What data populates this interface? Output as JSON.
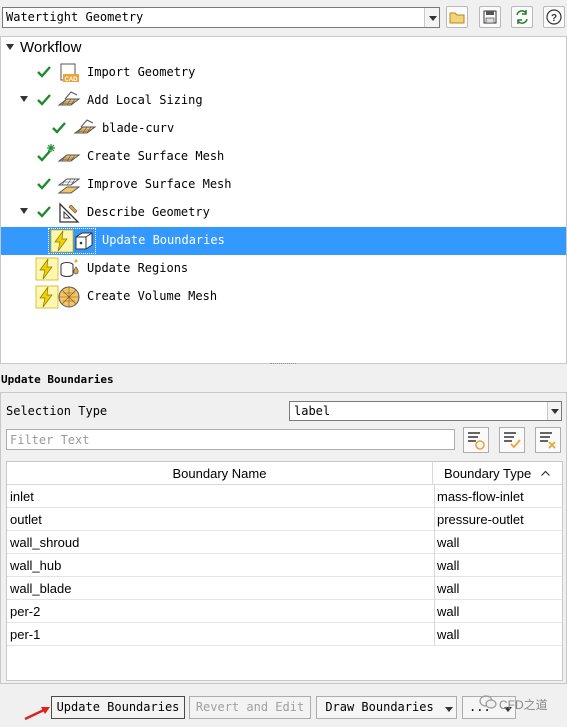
{
  "header": {
    "workflow_select": "Watertight Geometry"
  },
  "tree": {
    "root": "Workflow",
    "items": [
      {
        "label": "Import Geometry"
      },
      {
        "label": "Add Local Sizing"
      },
      {
        "label": "blade-curv"
      },
      {
        "label": "Create Surface Mesh"
      },
      {
        "label": "Improve Surface Mesh"
      },
      {
        "label": "Describe Geometry"
      },
      {
        "label": "Update Boundaries"
      },
      {
        "label": "Update Regions"
      },
      {
        "label": "Create Volume Mesh"
      }
    ],
    "icon_labels": {
      "cad": "CAD"
    }
  },
  "section": {
    "title": "Update Boundaries",
    "selection_type_label": "Selection Type",
    "selection_type_value": "label",
    "filter_placeholder": "Filter Text"
  },
  "table": {
    "columns": [
      "Boundary Name",
      "Boundary Type"
    ],
    "rows": [
      {
        "name": "inlet",
        "type": "mass-flow-inlet"
      },
      {
        "name": "outlet",
        "type": "pressure-outlet"
      },
      {
        "name": "wall_shroud",
        "type": "wall"
      },
      {
        "name": "wall_hub",
        "type": "wall"
      },
      {
        "name": "wall_blade",
        "type": "wall"
      },
      {
        "name": "per-2",
        "type": "wall"
      },
      {
        "name": "per-1",
        "type": "wall"
      }
    ]
  },
  "buttons": {
    "update": "Update Boundaries",
    "revert": "Revert and Edit",
    "draw": "Draw Boundaries",
    "more": "..."
  },
  "watermark": "CFD之道",
  "colors": {
    "selection": "#3399ff",
    "check": "#1e8c2e",
    "lightning": "#f2d100",
    "mesh_icon": "#e0a83a",
    "pointer": "#e02020"
  }
}
